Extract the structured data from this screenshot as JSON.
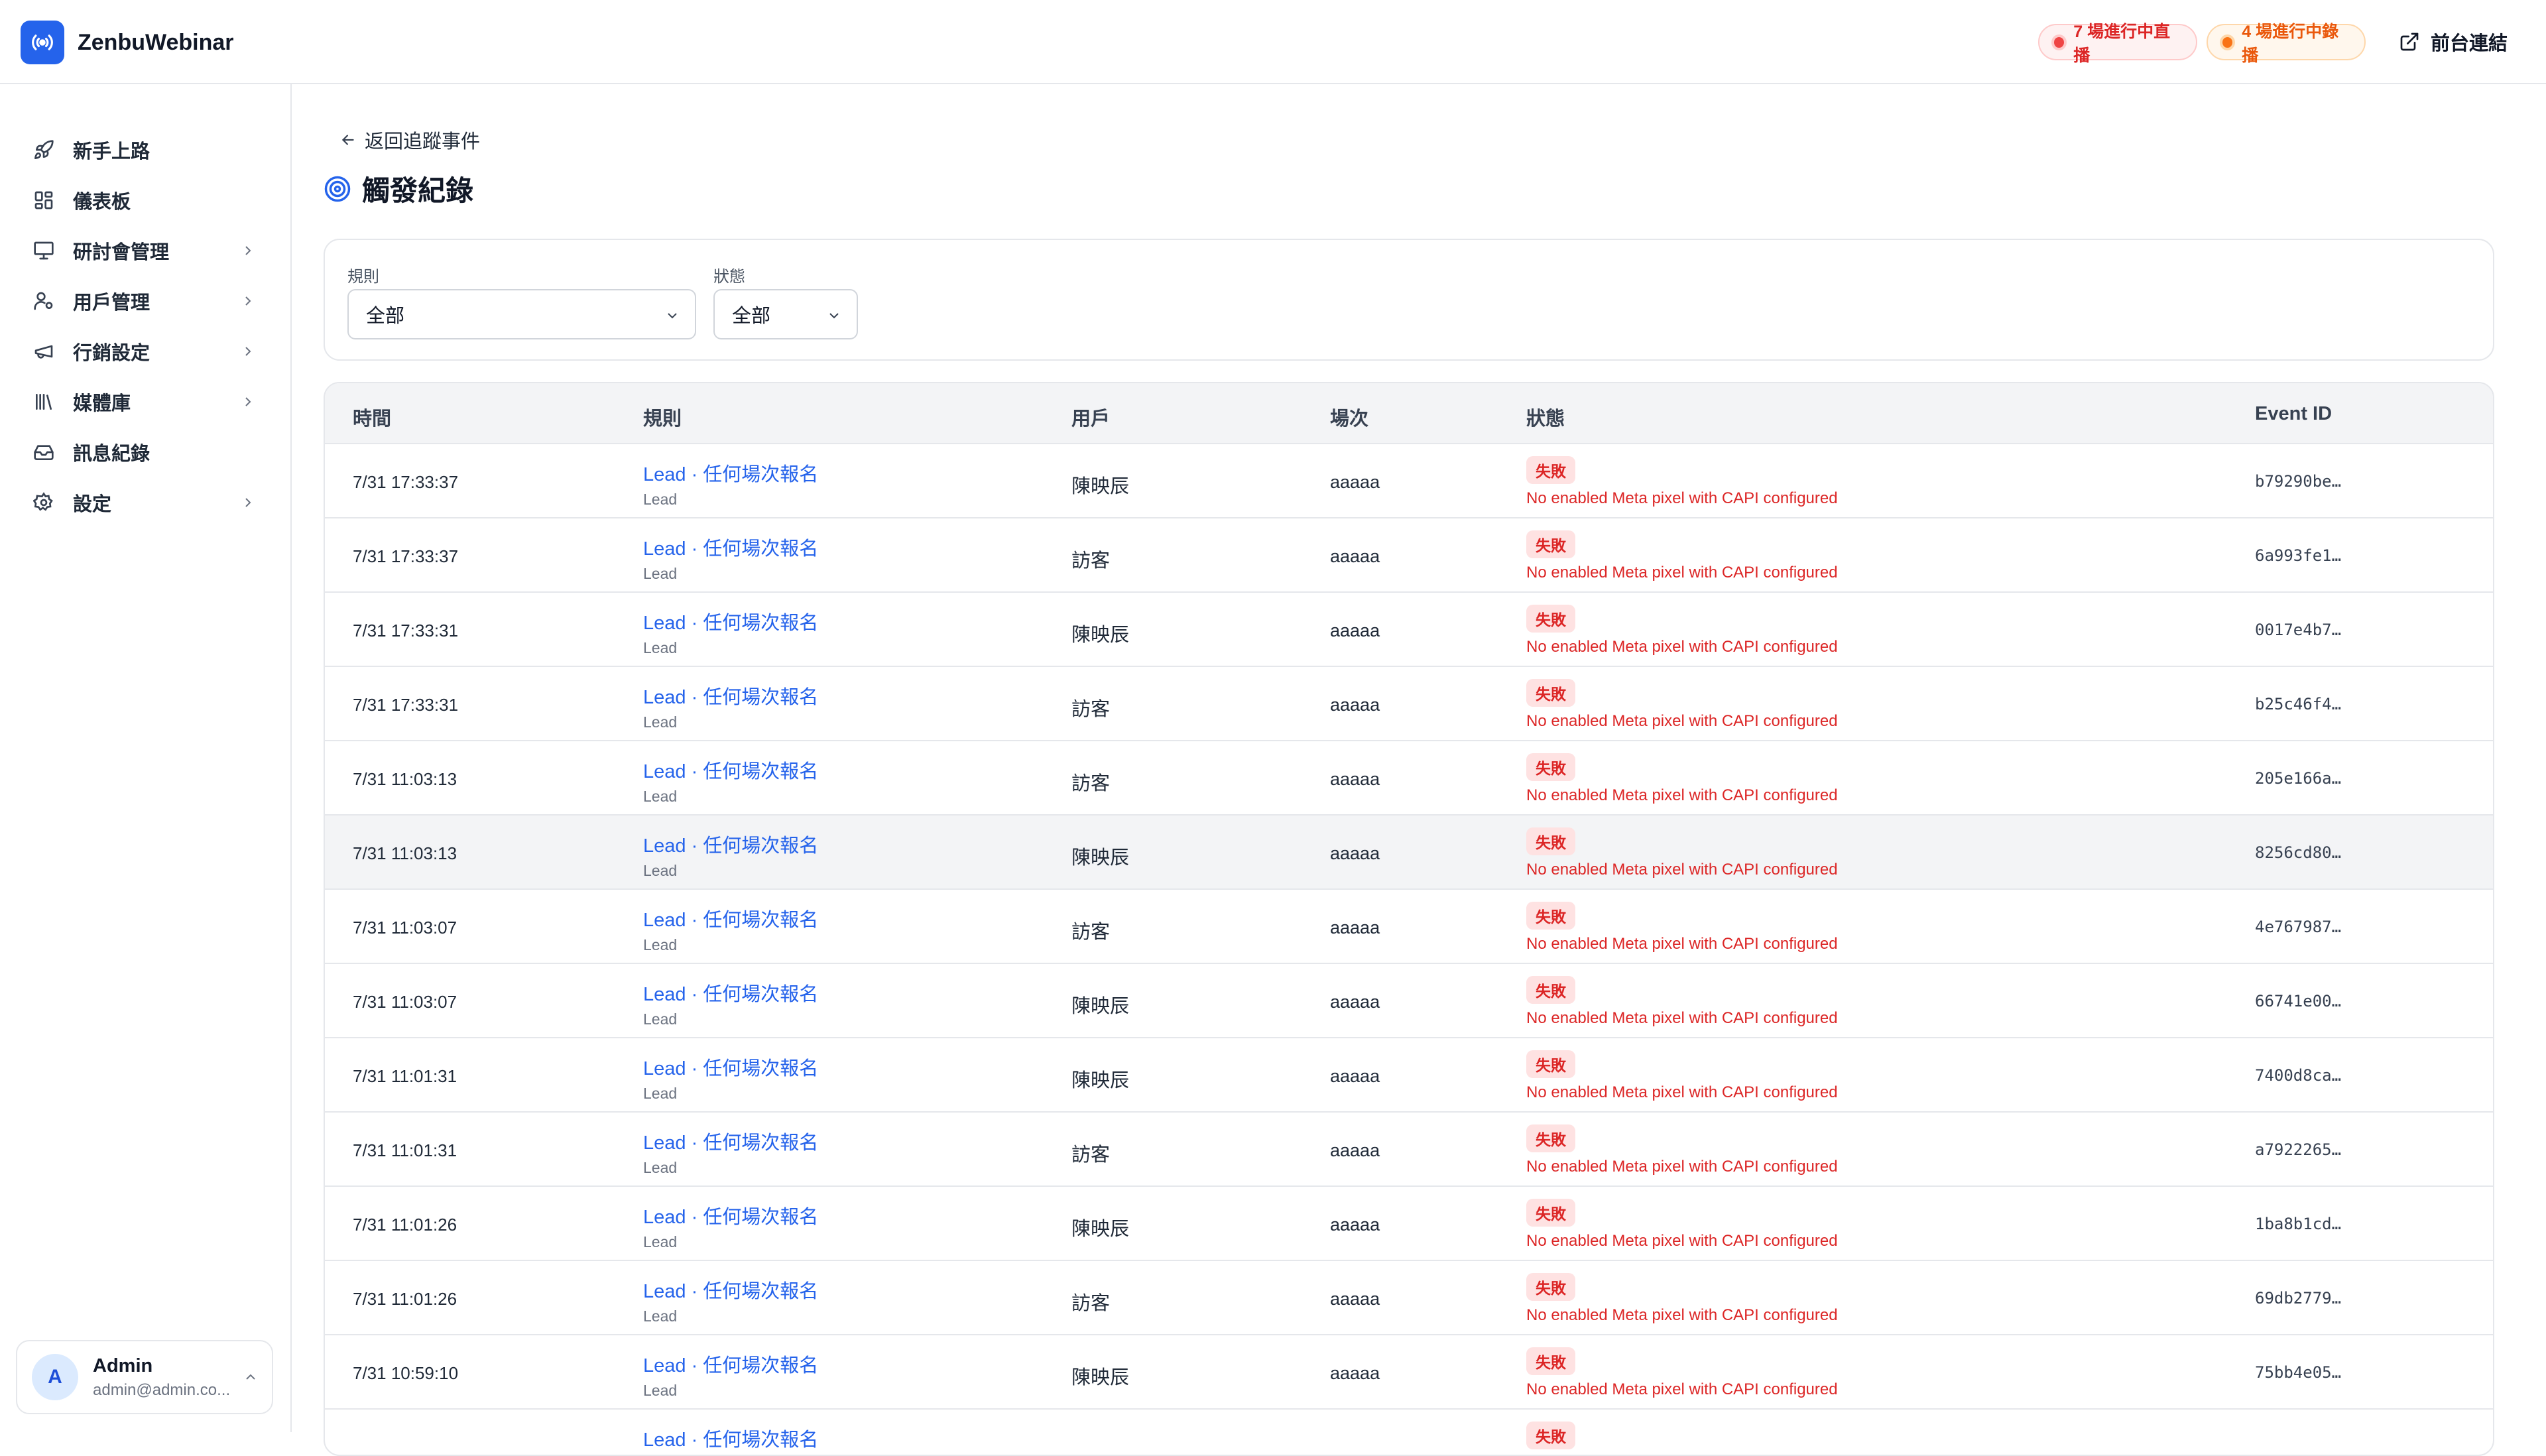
{
  "app": {
    "name": "ZenbuWebinar"
  },
  "header": {
    "live_badge": "7 場進行中直播",
    "recording_badge": "4 場進行中錄播",
    "front_link": "前台連結"
  },
  "sidebar": {
    "items": [
      {
        "label": "新手上路",
        "icon": "rocket-icon",
        "has_children": false
      },
      {
        "label": "儀表板",
        "icon": "dashboard-icon",
        "has_children": false
      },
      {
        "label": "研討會管理",
        "icon": "presentation-icon",
        "has_children": true
      },
      {
        "label": "用戶管理",
        "icon": "user-gear-icon",
        "has_children": true
      },
      {
        "label": "行銷設定",
        "icon": "megaphone-icon",
        "has_children": true
      },
      {
        "label": "媒體庫",
        "icon": "library-icon",
        "has_children": true
      },
      {
        "label": "訊息紀錄",
        "icon": "inbox-icon",
        "has_children": false
      },
      {
        "label": "設定",
        "icon": "gear-icon",
        "has_children": true
      }
    ],
    "user": {
      "initial": "A",
      "name": "Admin",
      "email": "admin@admin.co..."
    }
  },
  "page": {
    "back_label": "返回追蹤事件",
    "title": "觸發紀錄"
  },
  "filters": {
    "rule_label": "規則",
    "rule_value": "全部",
    "status_label": "狀態",
    "status_value": "全部"
  },
  "table": {
    "columns": [
      "時間",
      "規則",
      "用戶",
      "場次",
      "狀態",
      "Event ID"
    ],
    "rows": [
      {
        "time": "7/31 17:33:37",
        "rule": "Lead · 任何場次報名",
        "rule_sub": "Lead",
        "user": "陳映辰",
        "session": "aaaaa",
        "status": "失敗",
        "error": "No enabled Meta pixel with CAPI configured",
        "event_id": "b79290be…"
      },
      {
        "time": "7/31 17:33:37",
        "rule": "Lead · 任何場次報名",
        "rule_sub": "Lead",
        "user": "訪客",
        "session": "aaaaa",
        "status": "失敗",
        "error": "No enabled Meta pixel with CAPI configured",
        "event_id": "6a993fe1…"
      },
      {
        "time": "7/31 17:33:31",
        "rule": "Lead · 任何場次報名",
        "rule_sub": "Lead",
        "user": "陳映辰",
        "session": "aaaaa",
        "status": "失敗",
        "error": "No enabled Meta pixel with CAPI configured",
        "event_id": "0017e4b7…"
      },
      {
        "time": "7/31 17:33:31",
        "rule": "Lead · 任何場次報名",
        "rule_sub": "Lead",
        "user": "訪客",
        "session": "aaaaa",
        "status": "失敗",
        "error": "No enabled Meta pixel with CAPI configured",
        "event_id": "b25c46f4…"
      },
      {
        "time": "7/31 11:03:13",
        "rule": "Lead · 任何場次報名",
        "rule_sub": "Lead",
        "user": "訪客",
        "session": "aaaaa",
        "status": "失敗",
        "error": "No enabled Meta pixel with CAPI configured",
        "event_id": "205e166a…"
      },
      {
        "time": "7/31 11:03:13",
        "rule": "Lead · 任何場次報名",
        "rule_sub": "Lead",
        "user": "陳映辰",
        "session": "aaaaa",
        "status": "失敗",
        "error": "No enabled Meta pixel with CAPI configured",
        "event_id": "8256cd80…"
      },
      {
        "time": "7/31 11:03:07",
        "rule": "Lead · 任何場次報名",
        "rule_sub": "Lead",
        "user": "訪客",
        "session": "aaaaa",
        "status": "失敗",
        "error": "No enabled Meta pixel with CAPI configured",
        "event_id": "4e767987…"
      },
      {
        "time": "7/31 11:03:07",
        "rule": "Lead · 任何場次報名",
        "rule_sub": "Lead",
        "user": "陳映辰",
        "session": "aaaaa",
        "status": "失敗",
        "error": "No enabled Meta pixel with CAPI configured",
        "event_id": "66741e00…"
      },
      {
        "time": "7/31 11:01:31",
        "rule": "Lead · 任何場次報名",
        "rule_sub": "Lead",
        "user": "陳映辰",
        "session": "aaaaa",
        "status": "失敗",
        "error": "No enabled Meta pixel with CAPI configured",
        "event_id": "7400d8ca…"
      },
      {
        "time": "7/31 11:01:31",
        "rule": "Lead · 任何場次報名",
        "rule_sub": "Lead",
        "user": "訪客",
        "session": "aaaaa",
        "status": "失敗",
        "error": "No enabled Meta pixel with CAPI configured",
        "event_id": "a7922265…"
      },
      {
        "time": "7/31 11:01:26",
        "rule": "Lead · 任何場次報名",
        "rule_sub": "Lead",
        "user": "陳映辰",
        "session": "aaaaa",
        "status": "失敗",
        "error": "No enabled Meta pixel with CAPI configured",
        "event_id": "1ba8b1cd…"
      },
      {
        "time": "7/31 11:01:26",
        "rule": "Lead · 任何場次報名",
        "rule_sub": "Lead",
        "user": "訪客",
        "session": "aaaaa",
        "status": "失敗",
        "error": "No enabled Meta pixel with CAPI configured",
        "event_id": "69db2779…"
      },
      {
        "time": "7/31 10:59:10",
        "rule": "Lead · 任何場次報名",
        "rule_sub": "Lead",
        "user": "陳映辰",
        "session": "aaaaa",
        "status": "失敗",
        "error": "No enabled Meta pixel with CAPI configured",
        "event_id": "75bb4e05…"
      },
      {
        "time": "",
        "rule": "Lead · 任何場次報名",
        "rule_sub": "",
        "user": "",
        "session": "",
        "status": "失敗",
        "error": "",
        "event_id": ""
      }
    ]
  },
  "colors": {
    "brand": "#2563eb",
    "link": "#2563eb",
    "error": "#dc2626",
    "live": "#ef4444",
    "recording": "#f97316"
  }
}
